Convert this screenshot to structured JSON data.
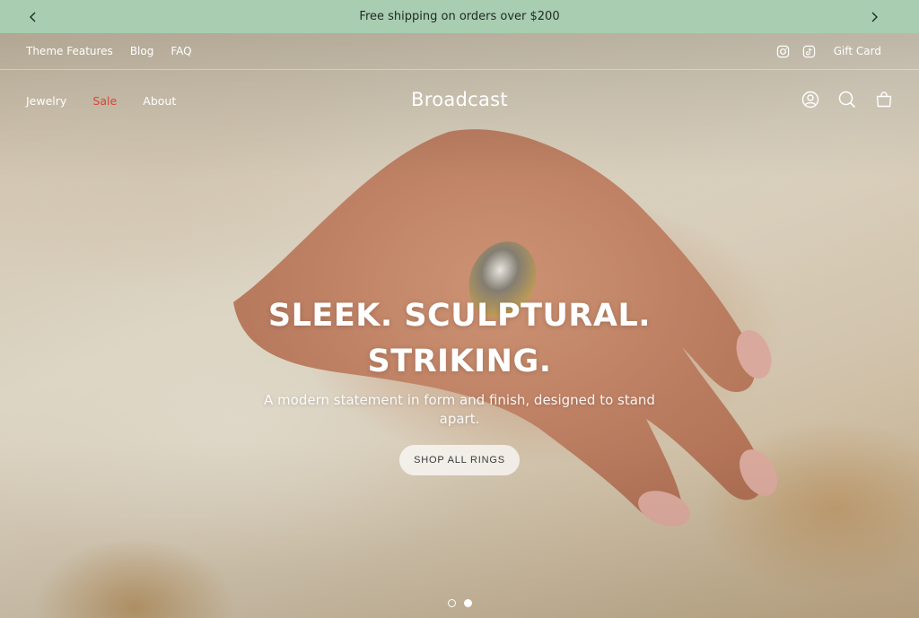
{
  "announcement": {
    "text": "Free shipping on orders over $200",
    "prev_icon": "chevron-left-icon",
    "next_icon": "chevron-right-icon",
    "background": "#a8cdb1"
  },
  "utility_nav": {
    "links": [
      "Theme Features",
      "Blog",
      "FAQ"
    ],
    "social_icons": [
      "instagram-icon",
      "tiktok-icon"
    ],
    "gift_card": "Gift Card"
  },
  "main_nav": {
    "links": [
      {
        "label": "Jewelry"
      },
      {
        "label": "Sale",
        "color": "#d8453a"
      },
      {
        "label": "About"
      }
    ],
    "logo": "Broadcast",
    "icons": [
      "account-icon",
      "search-icon",
      "cart-icon"
    ]
  },
  "hero": {
    "title_line1": "SLEEK. SCULPTURAL.",
    "title_line2": "STRIKING.",
    "subtitle": "A modern statement in form and finish, designed to stand apart.",
    "button": "SHOP ALL RINGS",
    "slides_total": 2,
    "active_slide": 2
  }
}
